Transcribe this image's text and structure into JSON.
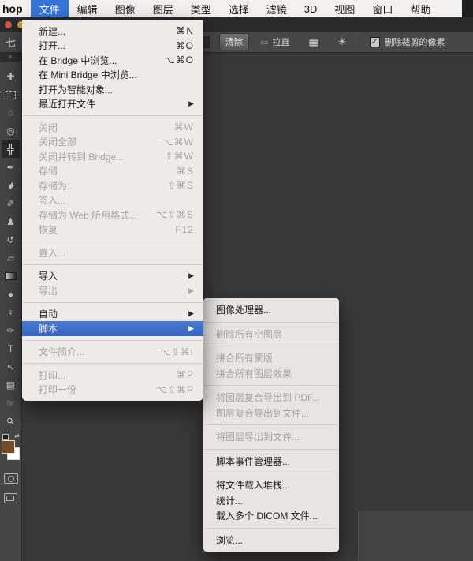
{
  "menubar": {
    "app_name_partial": "hop",
    "items": [
      {
        "label": "文件",
        "active": true
      },
      {
        "label": "编辑"
      },
      {
        "label": "图像"
      },
      {
        "label": "图层"
      },
      {
        "label": "类型"
      },
      {
        "label": "选择"
      },
      {
        "label": "滤镜"
      },
      {
        "label": "3D"
      },
      {
        "label": "视图"
      },
      {
        "label": "窗口"
      },
      {
        "label": "帮助"
      }
    ]
  },
  "options_bar": {
    "clear_button": "清除",
    "straighten_label": "拉直",
    "delete_cropped_label": "删除裁剪的像素",
    "checkbox_checked": true,
    "icons": {
      "crop": "七",
      "straighten_level": "▭",
      "grid": "▦",
      "gear": "✳",
      "check": "✓"
    }
  },
  "file_menu": {
    "groups": [
      [
        {
          "label": "新建...",
          "shortcut": "⌘N"
        },
        {
          "label": "打开...",
          "shortcut": "⌘O"
        },
        {
          "label": "在 Bridge 中浏览...",
          "shortcut": "⌥⌘O"
        },
        {
          "label": "在 Mini Bridge 中浏览..."
        },
        {
          "label": "打开为智能对象..."
        },
        {
          "label": "最近打开文件",
          "submenu": true
        }
      ],
      [
        {
          "label": "关闭",
          "shortcut": "⌘W",
          "disabled": true
        },
        {
          "label": "关闭全部",
          "shortcut": "⌥⌘W",
          "disabled": true
        },
        {
          "label": "关闭并转到 Bridge...",
          "shortcut": "⇧⌘W",
          "disabled": true
        },
        {
          "label": "存储",
          "shortcut": "⌘S",
          "disabled": true
        },
        {
          "label": "存储为...",
          "shortcut": "⇧⌘S",
          "disabled": true
        },
        {
          "label": "签入...",
          "disabled": true
        },
        {
          "label": "存储为 Web 所用格式...",
          "shortcut": "⌥⇧⌘S",
          "disabled": true
        },
        {
          "label": "恢复",
          "shortcut": "F12",
          "disabled": true
        }
      ],
      [
        {
          "label": "置入...",
          "disabled": true
        }
      ],
      [
        {
          "label": "导入",
          "submenu": true
        },
        {
          "label": "导出",
          "submenu": true,
          "disabled": true
        }
      ],
      [
        {
          "label": "自动",
          "submenu": true
        },
        {
          "label": "脚本",
          "submenu": true,
          "highlighted": true
        }
      ],
      [
        {
          "label": "文件简介...",
          "shortcut": "⌥⇧⌘I",
          "disabled": true
        }
      ],
      [
        {
          "label": "打印...",
          "shortcut": "⌘P",
          "disabled": true
        },
        {
          "label": "打印一份",
          "shortcut": "⌥⇧⌘P",
          "disabled": true
        }
      ]
    ]
  },
  "scripts_submenu": {
    "groups": [
      [
        {
          "label": "图像处理器..."
        }
      ],
      [
        {
          "label": "删除所有空图层",
          "disabled": true
        }
      ],
      [
        {
          "label": "拼合所有蒙版",
          "disabled": true
        },
        {
          "label": "拼合所有图层效果",
          "disabled": true
        }
      ],
      [
        {
          "label": "将图层复合导出到 PDF...",
          "disabled": true
        },
        {
          "label": "图层复合导出到文件...",
          "disabled": true
        }
      ],
      [
        {
          "label": "将图层导出到文件...",
          "disabled": true
        }
      ],
      [
        {
          "label": "脚本事件管理器..."
        }
      ],
      [
        {
          "label": "将文件载入堆栈..."
        },
        {
          "label": "统计..."
        },
        {
          "label": "载入多个 DICOM 文件..."
        }
      ],
      [
        {
          "label": "浏览..."
        }
      ]
    ]
  },
  "toolbar": {
    "collapse_icon": "»",
    "tools": [
      {
        "name": "move-tool",
        "glyph": "✚"
      },
      {
        "name": "rectangular-marquee-tool",
        "glyph": "",
        "shape": "marquee"
      },
      {
        "name": "lasso-tool",
        "glyph": "◌"
      },
      {
        "name": "quick-selection-tool",
        "glyph": "◎"
      },
      {
        "name": "crop-tool",
        "glyph": "╬",
        "selected": true
      },
      {
        "name": "eyedropper-tool",
        "glyph": "✒"
      },
      {
        "name": "spot-healing-brush-tool",
        "glyph": "▰",
        "rotate": true
      },
      {
        "name": "brush-tool",
        "glyph": "✐"
      },
      {
        "name": "clone-stamp-tool",
        "glyph": "♟"
      },
      {
        "name": "history-brush-tool",
        "glyph": "↺"
      },
      {
        "name": "eraser-tool",
        "glyph": "▱"
      },
      {
        "name": "gradient-tool",
        "glyph": "",
        "shape": "gradient"
      },
      {
        "name": "blur-tool",
        "glyph": "●"
      },
      {
        "name": "dodge-tool",
        "glyph": "♀"
      },
      {
        "name": "pen-tool",
        "glyph": "✑"
      },
      {
        "name": "type-tool",
        "glyph": "T"
      },
      {
        "name": "path-selection-tool",
        "glyph": "↖"
      },
      {
        "name": "rectangle-tool",
        "glyph": "▤"
      },
      {
        "name": "hand-tool",
        "glyph": "☞"
      },
      {
        "name": "zoom-tool",
        "glyph": "⚲",
        "rotate": true
      }
    ],
    "foreground_color": "#7a4a21",
    "background_color": "#ffffff",
    "swap_icon": "⇄"
  },
  "colors": {
    "menu_highlight": "#3a6cc8",
    "menubar_active": "#3875d7",
    "traffic_red": "#d8544f",
    "traffic_yellow": "#d9a13e"
  }
}
